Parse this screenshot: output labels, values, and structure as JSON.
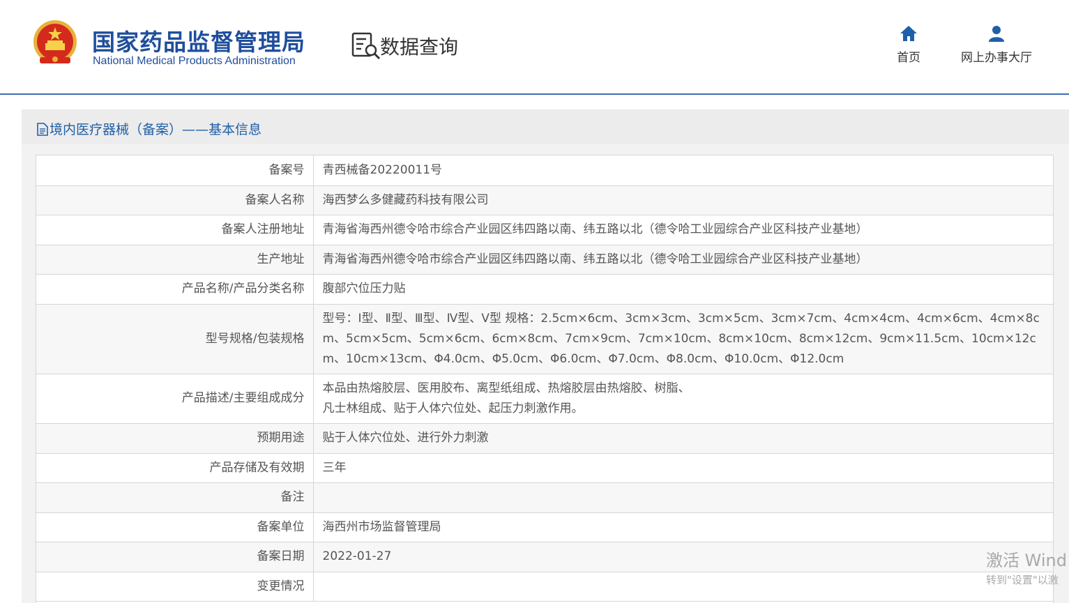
{
  "header": {
    "agency_cn": "国家药品监督管理局",
    "agency_en": "National Medical Products Administration",
    "section_title": "数据查询",
    "nav": [
      {
        "label": "首页",
        "icon": "home-icon"
      },
      {
        "label": "网上办事大厅",
        "icon": "user-icon"
      }
    ]
  },
  "panel": {
    "title": "境内医疗器械（备案）——基本信息",
    "icon": "document-icon"
  },
  "record": {
    "rows": [
      {
        "label": "备案号",
        "value": "青西械备20220011号"
      },
      {
        "label": "备案人名称",
        "value": "海西梦么多健藏药科技有限公司"
      },
      {
        "label": "备案人注册地址",
        "value": "青海省海西州德令哈市综合产业园区纬四路以南、纬五路以北（德令哈工业园综合产业区科技产业基地）"
      },
      {
        "label": "生产地址",
        "value": "青海省海西州德令哈市综合产业园区纬四路以南、纬五路以北（德令哈工业园综合产业区科技产业基地）"
      },
      {
        "label": "产品名称/产品分类名称",
        "value": "腹部穴位压力贴"
      },
      {
        "label": "型号规格/包装规格",
        "value": "型号：Ⅰ型、Ⅱ型、Ⅲ型、Ⅳ型、Ⅴ型 规格：2.5cm×6cm、3cm×3cm、3cm×5cm、3cm×7cm、4cm×4cm、4cm×6cm、4cm×8cm、5cm×5cm、5cm×6cm、6cm×8cm、7cm×9cm、7cm×10cm、8cm×10cm、8cm×12cm、9cm×11.5cm、10cm×12cm、10cm×13cm、Φ4.0cm、Φ5.0cm、Φ6.0cm、Φ7.0cm、Φ8.0cm、Φ10.0cm、Φ12.0cm"
      },
      {
        "label": "产品描述/主要组成成分",
        "value_line1": "本品由热熔胶层、医用胶布、离型纸组成、热熔胶层由热熔胶、树脂、",
        "value_line2": "凡士林组成、贴于人体穴位处、起压力刺激作用。"
      },
      {
        "label": "预期用途",
        "value": "贴于人体穴位处、进行外力刺激"
      },
      {
        "label": "产品存储及有效期",
        "value": "三年"
      },
      {
        "label": "备注",
        "value": ""
      },
      {
        "label": "备案单位",
        "value": "海西州市场监督管理局"
      },
      {
        "label": "备案日期",
        "value": "2022-01-27"
      },
      {
        "label": "变更情况",
        "value": ""
      }
    ]
  },
  "watermark": {
    "line1": "激活 Wind",
    "line2": "转到\"设置\"以激"
  }
}
